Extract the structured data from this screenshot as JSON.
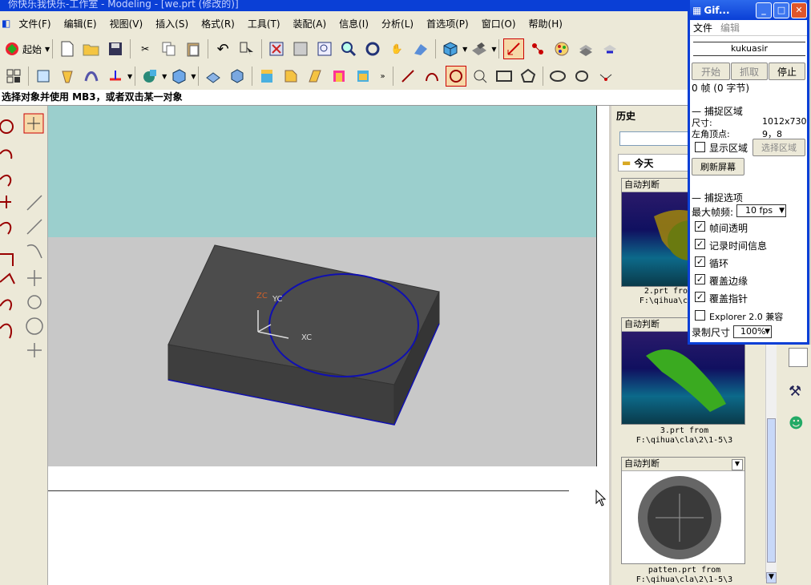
{
  "window": {
    "title": "你快乐我快乐-工作室 - Modeling - [we.prt (修改的)]"
  },
  "menus": [
    "文件(F)",
    "编辑(E)",
    "视图(V)",
    "插入(S)",
    "格式(R)",
    "工具(T)",
    "装配(A)",
    "信息(I)",
    "分析(L)",
    "首选项(P)",
    "窗口(O)",
    "帮助(H)"
  ],
  "toolbar": {
    "start_label": "起始"
  },
  "status": {
    "prompt": "选择对象并使用 MB3，或者双击某一对象"
  },
  "viewport": {
    "axis_labels": {
      "zc": "ZC",
      "yc": "YC",
      "xc": "XC"
    },
    "colors": {
      "background_top": "#9bcfcd",
      "background_bottom": "#c8c8c8",
      "block": "#4a4a4a",
      "circle": "#1010b0"
    }
  },
  "history": {
    "title": "历史",
    "group_label": "今天",
    "items": [
      {
        "mode": "自动判断",
        "caption1": "2.prt from",
        "caption2": "F:\\qihua\\cla"
      },
      {
        "mode": "自动判断",
        "caption1": "3.prt from",
        "caption2": "F:\\qihua\\cla\\2\\1-5\\3"
      },
      {
        "mode": "自动判断",
        "caption1": "patten.prt from",
        "caption2": "F:\\qihua\\cla\\2\\1-5\\3"
      }
    ]
  },
  "gif_recorder": {
    "title": "Gif...",
    "menu": [
      "文件",
      "编辑"
    ],
    "user": "kukuasir",
    "buttons": {
      "start": "开始",
      "capture": "抓取",
      "stop": "停止"
    },
    "frames_info": "0 帧 (0 字节)",
    "capture_area": {
      "heading": "捕捉区域",
      "size_label": "尺寸:",
      "size_value": "1012x730",
      "corner_label": "左角顶点:",
      "corner_value": "9，8",
      "show_area": "显示区域",
      "select_area": "选择区域",
      "refresh": "刷新屏幕"
    },
    "capture_options": {
      "heading": "捕捉选项",
      "max_fps_label": "最大帧频:",
      "max_fps_value": "10 fps",
      "checks": [
        {
          "label": "帧间透明",
          "checked": true
        },
        {
          "label": "记录时间信息",
          "checked": true
        },
        {
          "label": "循环",
          "checked": true
        },
        {
          "label": "覆盖边缘",
          "checked": true
        },
        {
          "label": "覆盖指针",
          "checked": true
        },
        {
          "label": "Explorer 2.0 兼容",
          "checked": false
        }
      ],
      "record_size_label": "录制尺寸",
      "record_size_value": "100%"
    }
  }
}
